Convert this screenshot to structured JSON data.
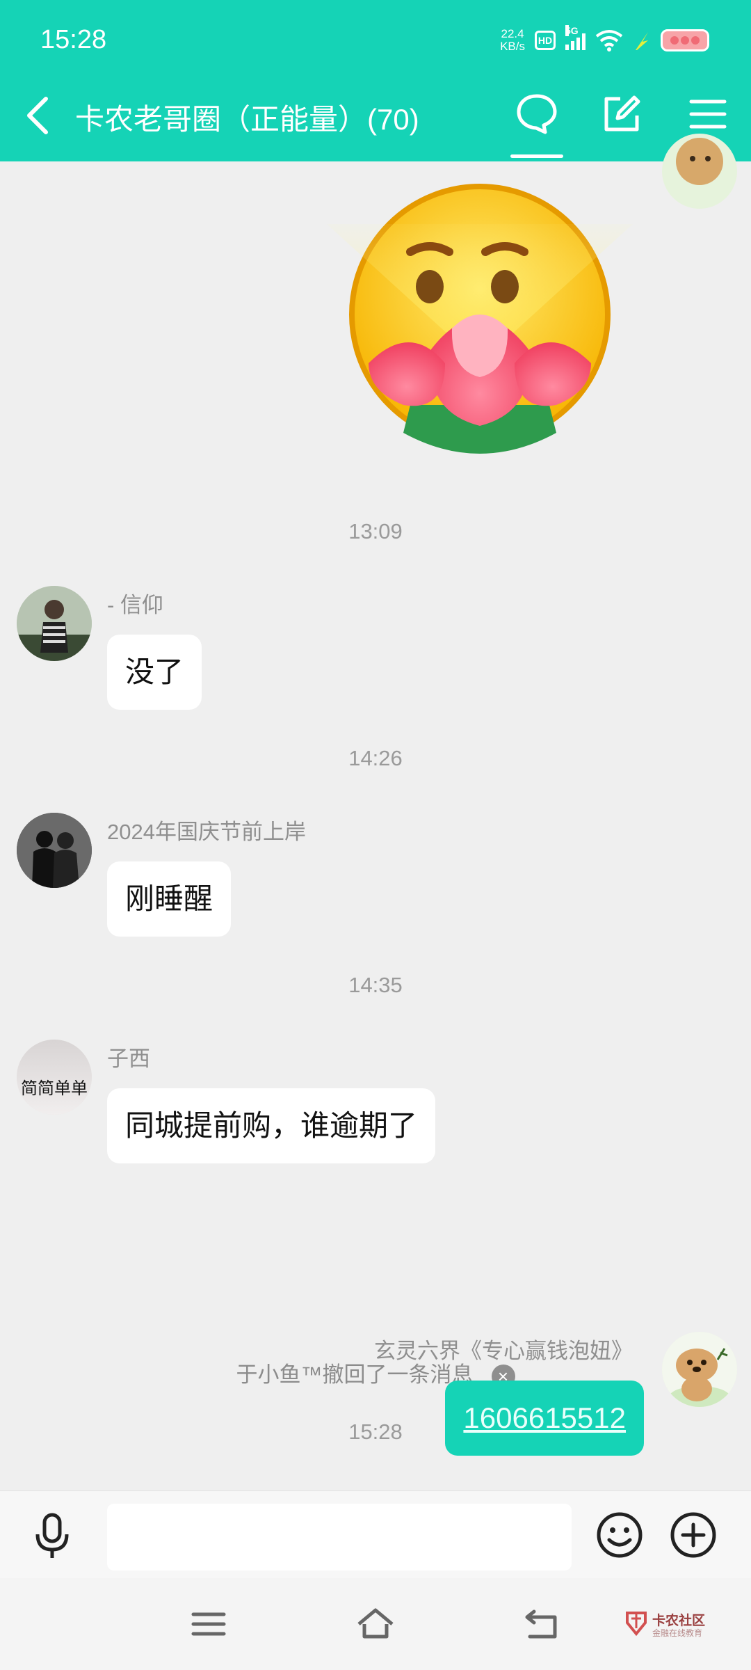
{
  "status_bar": {
    "time": "15:28",
    "net_speed_value": "22.4",
    "net_speed_unit": "KB/s",
    "hd": "HD",
    "network": "5G"
  },
  "header": {
    "title": "卡农老哥圈（正能量）(70)",
    "icons": [
      "back-icon",
      "chat-icon",
      "edit-icon",
      "menu-icon"
    ]
  },
  "messages": [
    {
      "type": "timestamp",
      "text": "13:09"
    },
    {
      "type": "incoming",
      "sender": "- 信仰",
      "text": "没了"
    },
    {
      "type": "timestamp",
      "text": "14:26"
    },
    {
      "type": "incoming",
      "sender": "2024年国庆节前上岸",
      "text": "刚睡醒"
    },
    {
      "type": "timestamp",
      "text": "14:35"
    },
    {
      "type": "incoming",
      "sender": "子西",
      "avatar_text": "简简单单",
      "text": "同城提前购，谁逾期了"
    },
    {
      "type": "system",
      "text": "于小鱼™撤回了一条消息"
    },
    {
      "type": "timestamp",
      "text": "15:28"
    },
    {
      "type": "outgoing",
      "sender": "玄灵六界《专心赢钱泡妞》",
      "text": "1606615512"
    }
  ],
  "input_bar": {
    "placeholder": "",
    "icons": [
      "mic-icon",
      "emoji-icon",
      "plus-icon"
    ]
  },
  "nav_bar": {
    "icons": [
      "menu-icon",
      "home-icon",
      "back-icon"
    ],
    "watermark_title": "卡农社区",
    "watermark_sub": "金融在线教育"
  },
  "colors": {
    "accent": "#15d3b6",
    "background": "#efefef",
    "bubble": "#ffffff"
  }
}
